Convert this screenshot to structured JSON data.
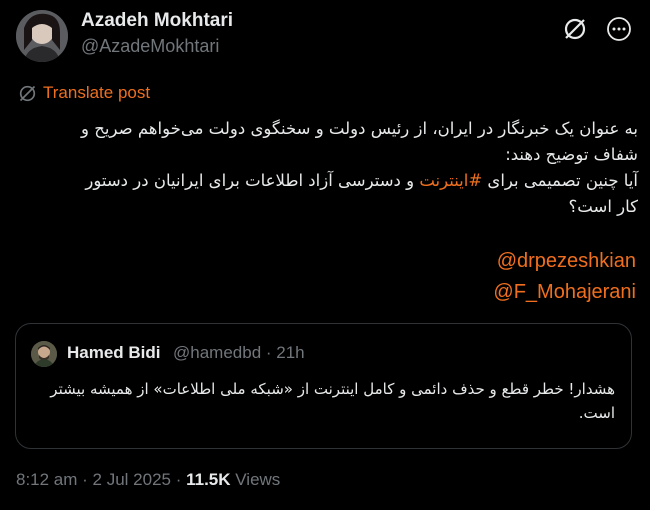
{
  "author": {
    "name": "Azadeh Mokhtari",
    "handle": "@AzadeMokhtari"
  },
  "icons": {
    "x_logo": "x-logo-icon",
    "more": "more-options-icon",
    "translate": "globe-icon"
  },
  "translate_label": "Translate post",
  "tweet": {
    "line1": "به عنوان یک خبرنگار در ایران، از رئیس دولت و سخنگوی دولت می‌خواهم صریح و",
    "line2": "شفاف توضیح دهند:",
    "line3_before": "آیا چنین تصمیمی برای ",
    "hashtag": "#اینترنت",
    "line3_after": " و دسترسی آزاد اطلاعات برای ایرانیان در دستور",
    "line4": "کار است؟",
    "mention1": "@drpezeshkian",
    "mention2": "@F_Mohajerani"
  },
  "quote": {
    "name": "Hamed Bidi",
    "handle": "@hamedbd",
    "time": "· 21h",
    "line1": "هشدار! خطر قطع و حذف دائمی و کامل اینترنت از «شبکه ملی اطلاعات» از همیشه بیشتر",
    "line2": "است."
  },
  "footer": {
    "time": "8:12 am",
    "sep1": " · ",
    "date": "2 Jul 2025",
    "sep2": " · ",
    "views_count": "11.5K",
    "views_label": " Views"
  },
  "colors": {
    "background": "#000000",
    "text": "#e7e9ea",
    "muted": "#71767b",
    "accent": "#ef6f1e",
    "border": "#2f3336"
  }
}
